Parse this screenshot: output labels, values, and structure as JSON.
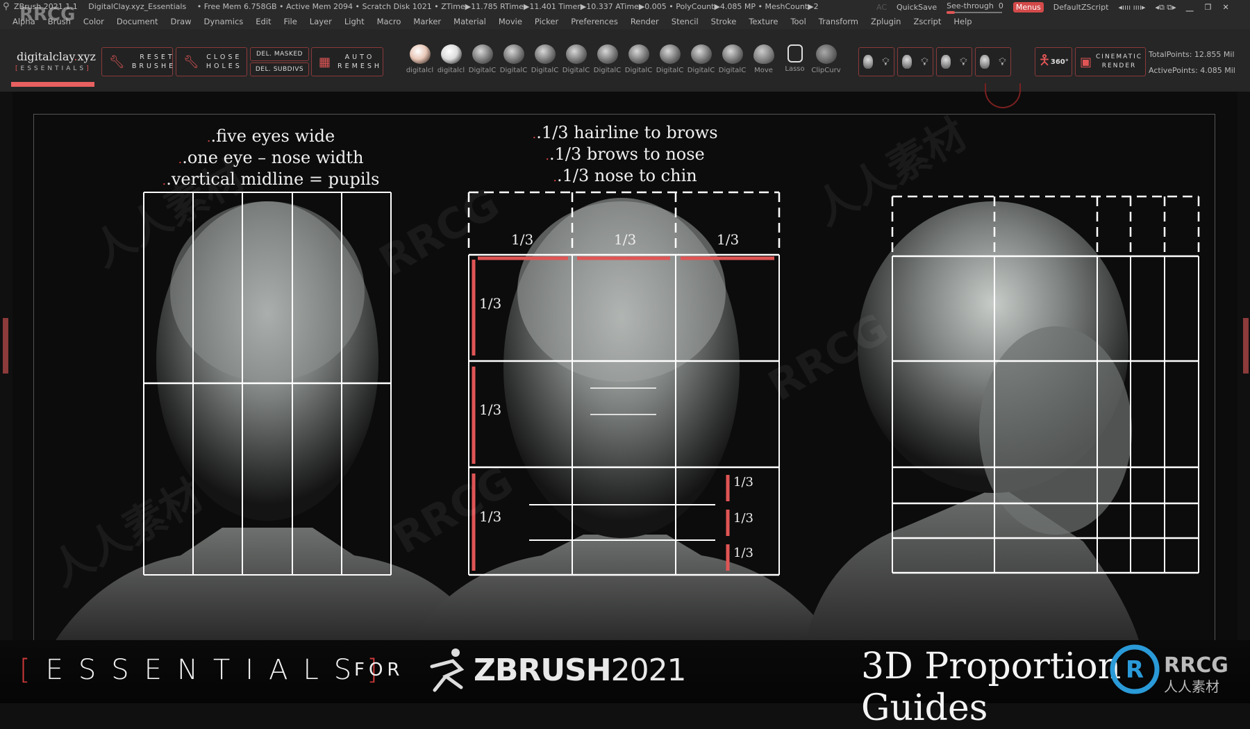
{
  "titlebar": {
    "app": "ZBrush 2021.1.1",
    "document": "DigitalClay.xyz_Essentials",
    "stats": "• Free Mem 6.758GB • Active Mem 2094 • Scratch Disk 1021 • ZTime▶11.785 RTime▶11.401 Timer▶10.337 ATime▶0.005 • PolyCount▶4.085 MP • MeshCount▶2",
    "ac": "AC",
    "quicksave": "QuickSave",
    "see_through_label": "See-through",
    "see_through_value": "0",
    "menus": "Menus",
    "script": "DefaultZScript",
    "window_controls": [
      "◂ıııı ıııı▸",
      "◂⧉ ⧉▸",
      "minimize",
      "restore",
      "close"
    ]
  },
  "menubar": [
    "Alpha",
    "Brush",
    "Color",
    "Document",
    "Draw",
    "Dynamics",
    "Edit",
    "File",
    "Layer",
    "Light",
    "Macro",
    "Marker",
    "Material",
    "Movie",
    "Picker",
    "Preferences",
    "Render",
    "Stencil",
    "Stroke",
    "Texture",
    "Tool",
    "Transform",
    "Zplugin",
    "Zscript",
    "Help"
  ],
  "toolbar": {
    "brand": {
      "name_a": "digitalclay",
      "dot": ".",
      "name_b": "xyz",
      "sub": "ESSENTIALS",
      "accent": "#e05555"
    },
    "reset_brushes": {
      "line1": "RESET",
      "line2": "BRUSHES",
      "icon": "wrench-icon"
    },
    "close_holes": {
      "line1": "CLOSE",
      "line2": "HOLES",
      "icon": "wrench-icon"
    },
    "del_masked": "DEL. MASKED",
    "del_subdivs": "DEL. SUBDIVS",
    "auto_remesh": {
      "line1": "AUTO",
      "line2": "REMESH",
      "icon": "cube-grid-icon"
    },
    "brushes": [
      {
        "name": "digitalcl",
        "style": "skin"
      },
      {
        "name": "digitalcl",
        "style": "white"
      },
      {
        "name": "DigitalC",
        "style": "clay"
      },
      {
        "name": "DigitalC",
        "style": "clay"
      },
      {
        "name": "DigitalC",
        "style": "clay"
      },
      {
        "name": "DigitalC",
        "style": "clay"
      },
      {
        "name": "DigitalC",
        "style": "clay"
      },
      {
        "name": "DigitalC",
        "style": "clay"
      },
      {
        "name": "DigitalC",
        "style": "clay"
      },
      {
        "name": "DigitalC",
        "style": "clay"
      },
      {
        "name": "DigitalC",
        "style": "clay"
      },
      {
        "name": "Move",
        "style": "move"
      },
      {
        "name": "Lasso",
        "style": "lasso"
      },
      {
        "name": "ClipCurv",
        "style": "clip"
      }
    ],
    "light_presets": 4,
    "turntable_label": "360°",
    "cinematic_render": {
      "line1": "CINEMATIC",
      "line2": "RENDER"
    },
    "total_points": "TotalPoints: 12.855 Mil",
    "active_points": "ActivePoints: 4.085 Mil"
  },
  "canvas": {
    "caption_front": [
      ".five eyes wide",
      ".one eye – nose width",
      ".vertical midline = pupils"
    ],
    "caption_thirds": [
      ".1/3 hairline to brows",
      ".1/3 brows to nose",
      ".1/3 nose to chin"
    ],
    "width_thirds": [
      "1/3",
      "1/3",
      "1/3"
    ],
    "height_thirds": [
      "1/3",
      "1/3",
      "1/3"
    ],
    "lower_thirds": [
      "1/3",
      "1/3",
      "1/3"
    ],
    "grid_color": "#ffffff",
    "accent_color": "#e05555"
  },
  "banner": {
    "bracket_open": "[",
    "essentials": "ESSENTIALS",
    "bracket_close": "]",
    "for": "FOR",
    "zbrush": "ZBRUSH",
    "year": "2021",
    "title": "3D Proportion Guides"
  },
  "watermark": {
    "text": "RRCG",
    "sub": "人人素材"
  }
}
